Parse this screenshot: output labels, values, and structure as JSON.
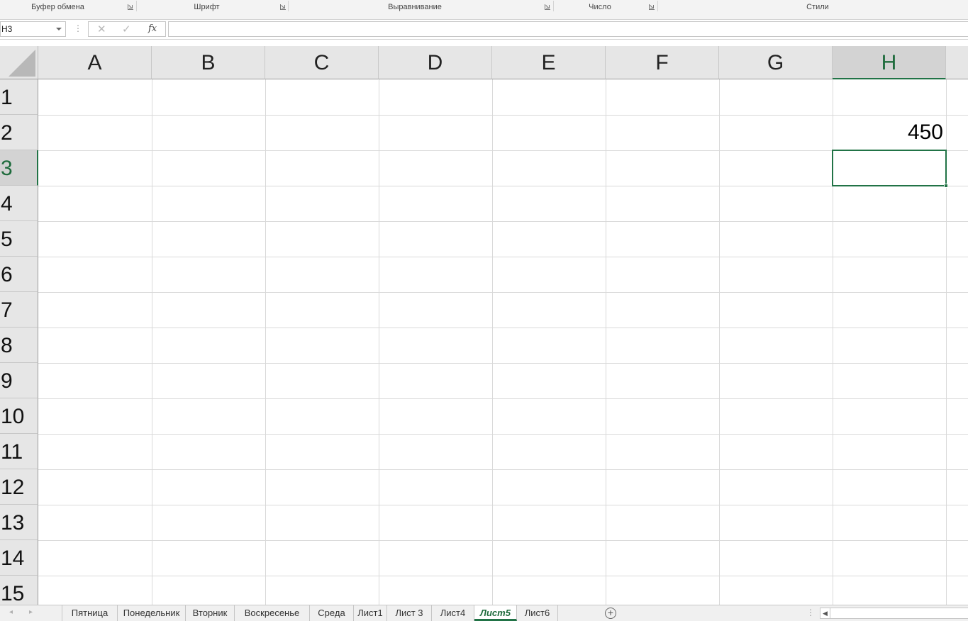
{
  "ribbon": {
    "groups": [
      {
        "label": "Буфер обмена"
      },
      {
        "label": "Шрифт"
      },
      {
        "label": "Выравнивание"
      },
      {
        "label": "Число"
      },
      {
        "label": "Стили"
      }
    ]
  },
  "formula_bar": {
    "name_box": "H3",
    "cancel_icon": "✕",
    "enter_icon": "✓",
    "fx_label": "fx",
    "formula_value": ""
  },
  "grid": {
    "columns": [
      "A",
      "B",
      "C",
      "D",
      "E",
      "F",
      "G",
      "H"
    ],
    "rows": [
      "1",
      "2",
      "3",
      "4",
      "5",
      "6",
      "7",
      "8",
      "9",
      "10",
      "11",
      "12",
      "13",
      "14",
      "15"
    ],
    "selected_column": "H",
    "selected_row": "3",
    "cells": [
      {
        "ref": "H2",
        "value": "450"
      }
    ]
  },
  "sheet_tabs": {
    "tabs": [
      {
        "label": "Пятница"
      },
      {
        "label": "Понедельник"
      },
      {
        "label": "Вторник"
      },
      {
        "label": "Воскресенье"
      },
      {
        "label": "Среда"
      },
      {
        "label": "Лист1"
      },
      {
        "label": "Лист 3"
      },
      {
        "label": "Лист4"
      },
      {
        "label": "Лист5",
        "active": true
      },
      {
        "label": "Лист6"
      }
    ],
    "add_sheet_icon": "+"
  },
  "colors": {
    "accent": "#217346",
    "header_bg": "#e6e6e6",
    "gridline": "#d9d9d9"
  }
}
